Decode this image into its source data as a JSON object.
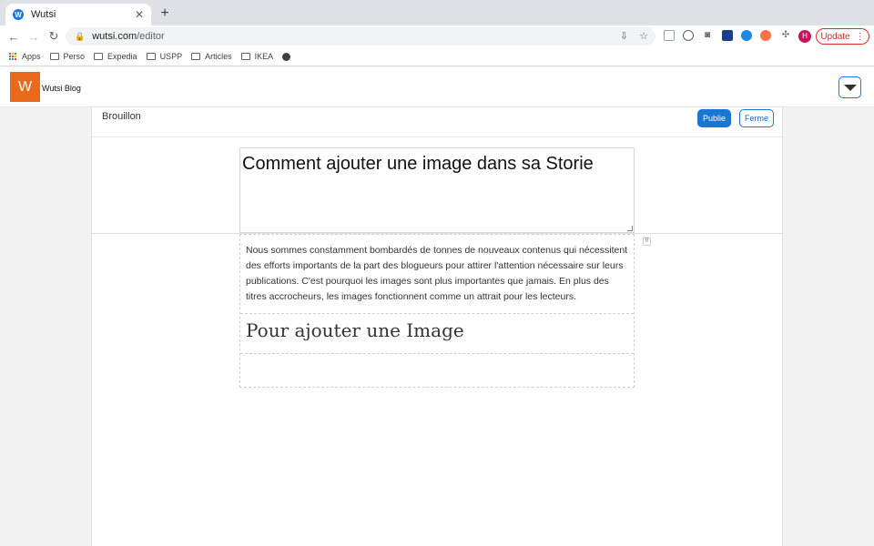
{
  "browser": {
    "tab_title": "Wutsi",
    "favicon_letter": "W",
    "tab_close": "✕",
    "new_tab": "+",
    "url_host": "wutsi.com",
    "url_path": "/editor",
    "update_label": "Update",
    "avatar_letter": "H",
    "bookmarks": [
      "Apps",
      "Perso",
      "Expedia",
      "USPP",
      "Articles",
      "IKEA"
    ]
  },
  "site": {
    "logo_letter": "W",
    "brand": "Wutsi Blog"
  },
  "editor": {
    "status": "Brouillon",
    "publish_label": "Publie",
    "close_label": "Ferme",
    "title": "Comment ajouter une image dans sa Storie",
    "paragraph": "Nous sommes constamment bombardés de tonnes de nouveaux contenus qui nécessitent des efforts importants de la part des blogueurs pour attirer l'attention nécessaire sur leurs publications. C'est pourquoi les images sont plus importantes que jamais. En plus des titres accrocheurs, les images fonctionnent comme un attrait pour les lecteurs.",
    "heading": "Pour ajouter une Image"
  },
  "colors": {
    "accent": "#1976d2",
    "logo": "#ea6a1b",
    "update": "#d93025"
  }
}
